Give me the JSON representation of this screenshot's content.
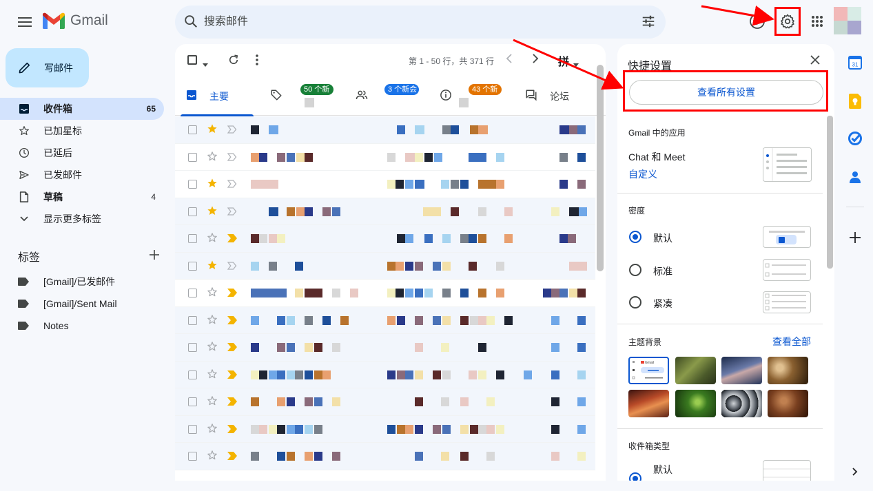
{
  "app": {
    "logo_text": "Gmail"
  },
  "search": {
    "placeholder": "搜索邮件"
  },
  "compose": {
    "label": "写邮件"
  },
  "nav": [
    {
      "label": "收件箱",
      "count": "65",
      "icon": "inbox-icon"
    },
    {
      "label": "已加星标",
      "count": "",
      "icon": "star-icon"
    },
    {
      "label": "已延后",
      "count": "",
      "icon": "clock-icon"
    },
    {
      "label": "已发邮件",
      "count": "",
      "icon": "send-icon"
    },
    {
      "label": "草稿",
      "count": "4",
      "icon": "draft-icon"
    },
    {
      "label": "显示更多标签",
      "count": "",
      "icon": "chevron-down-icon"
    }
  ],
  "labels": {
    "title": "标签",
    "items": [
      {
        "label": "[Gmail]/已发邮件"
      },
      {
        "label": "[Gmail]/Sent Mail"
      },
      {
        "label": "Notes"
      }
    ]
  },
  "toolbar": {
    "paging": "第 1 - 50 行，共 371 行",
    "ime_char": "拼"
  },
  "tabs": [
    {
      "label": "主要",
      "badge": "",
      "badge_color": ""
    },
    {
      "label": "",
      "badge": "50 个新",
      "badge_color": "#188038"
    },
    {
      "label": "",
      "badge": "3 个新会",
      "badge_color": "#1a73e8"
    },
    {
      "label": "",
      "badge": "43 个新",
      "badge_color": "#e37400"
    },
    {
      "label": "论坛",
      "badge": "",
      "badge_color": ""
    }
  ],
  "rows": [
    {
      "starred": true,
      "important": false,
      "read": true
    },
    {
      "starred": false,
      "important": false,
      "read": false
    },
    {
      "starred": true,
      "important": false,
      "read": false
    },
    {
      "starred": true,
      "important": false,
      "read": true
    },
    {
      "starred": false,
      "important": true,
      "read": true
    },
    {
      "starred": true,
      "important": false,
      "read": true
    },
    {
      "starred": false,
      "important": true,
      "read": false
    },
    {
      "starred": false,
      "important": true,
      "read": true
    },
    {
      "starred": false,
      "important": true,
      "read": true
    },
    {
      "starred": false,
      "important": true,
      "read": true
    },
    {
      "starred": false,
      "important": true,
      "read": true
    },
    {
      "starred": false,
      "important": true,
      "read": true
    },
    {
      "starred": false,
      "important": true,
      "read": true
    }
  ],
  "quick_settings": {
    "title": "快捷设置",
    "see_all": "查看所有设置",
    "apps_section": "Gmail 中的应用",
    "chat_meet": "Chat 和 Meet",
    "customize": "自定义",
    "density_section": "密度",
    "density_options": [
      {
        "label": "默认",
        "selected": true
      },
      {
        "label": "标准",
        "selected": false
      },
      {
        "label": "紧凑",
        "selected": false
      }
    ],
    "theme_section": "主题背景",
    "theme_see_all": "查看全部",
    "theme_thumb_label": "Gmail",
    "inbox_type_section": "收件箱类型",
    "inbox_type_default": "默认"
  },
  "colors": {
    "accent": "#0b57d0",
    "compose_bg": "#c2e7ff",
    "nav_active_bg": "#d3e3fd",
    "annotation": "#ff0000",
    "star": "#f4b400"
  }
}
